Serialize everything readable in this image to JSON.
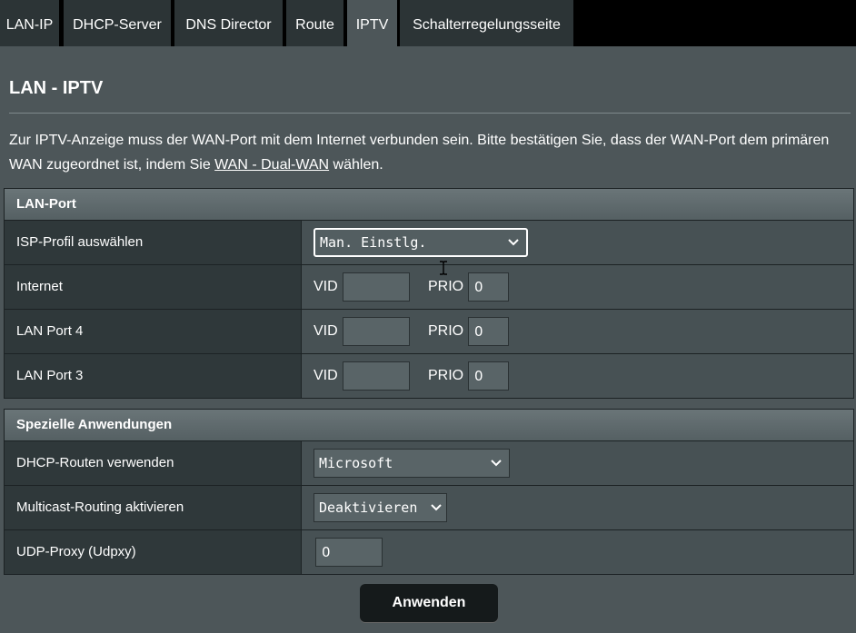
{
  "tabs": [
    {
      "label": "LAN-IP"
    },
    {
      "label": "DHCP-Server"
    },
    {
      "label": "DNS Director"
    },
    {
      "label": "Route"
    },
    {
      "label": "IPTV"
    },
    {
      "label": "Schalterregelungsseite"
    }
  ],
  "active_tab": "IPTV",
  "page": {
    "title": "LAN - IPTV",
    "intro_before": "Zur IPTV-Anzeige muss der WAN-Port mit dem Internet verbunden sein. Bitte bestätigen Sie, dass der WAN-Port dem primären WAN zugeordnet ist, indem Sie ",
    "intro_link": "WAN - Dual-WAN",
    "intro_after": " wählen."
  },
  "lan_port": {
    "header": "LAN-Port",
    "isp_label": "ISP-Profil auswählen",
    "isp_value": "Man. Einstlg.",
    "vid_label": "VID",
    "prio_label": "PRIO",
    "rows": [
      {
        "label": "Internet",
        "vid": "",
        "prio": "0"
      },
      {
        "label": "LAN Port 4",
        "vid": "",
        "prio": "0"
      },
      {
        "label": "LAN Port 3",
        "vid": "",
        "prio": "0"
      }
    ]
  },
  "special": {
    "header": "Spezielle Anwendungen",
    "dhcp_label": "DHCP-Routen verwenden",
    "dhcp_value": "Microsoft",
    "multicast_label": "Multicast-Routing aktivieren",
    "multicast_value": "Deaktivieren",
    "udp_label": "UDP-Proxy (Udpxy)",
    "udp_value": "0"
  },
  "apply_label": "Anwenden",
  "icons": {
    "dropdown": "chevron-down-icon",
    "cursor": "text-cursor-icon"
  }
}
